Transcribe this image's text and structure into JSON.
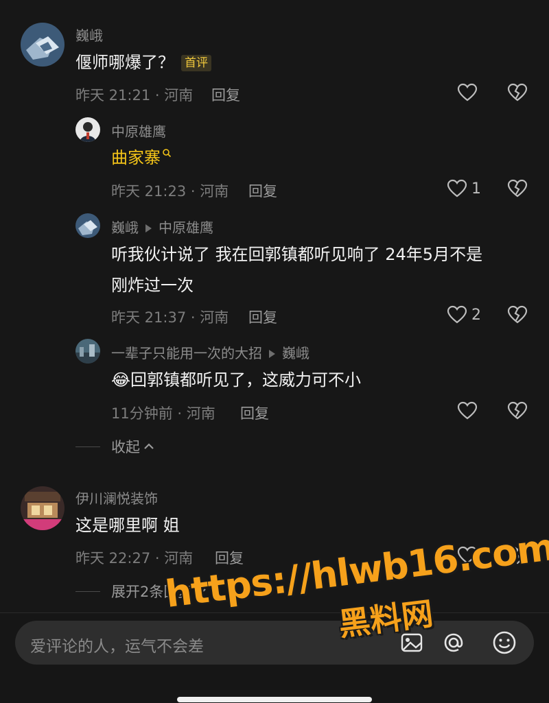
{
  "comments": [
    {
      "user": "巍峨",
      "text": "偃师哪爆了？",
      "badge": "首评",
      "time": "昨天 21:21 · 河南",
      "reply_label": "回复",
      "likes": ""
    },
    {
      "user": "伊川澜悦装饰",
      "text": "这是哪里啊 姐",
      "time": "昨天 22:27 · 河南",
      "reply_label": "回复",
      "likes": ""
    }
  ],
  "replies": [
    {
      "user": "中原雄鹰",
      "text": "曲家寨",
      "time": "昨天 21:23 · 河南",
      "reply_label": "回复",
      "likes": "1"
    },
    {
      "user": "巍峨",
      "reply_to": "中原雄鹰",
      "text_line1": "听我伙计说了 我在回郭镇都听见响了  24年5月不是",
      "text_line2": "刚炸过一次",
      "time": "昨天 21:37 · 河南",
      "reply_label": "回复",
      "likes": "2"
    },
    {
      "user": "一辈子只能用一次的大招",
      "reply_to": "巍峨",
      "text": "回郭镇都听见了，这威力可不小",
      "emoji": "😂",
      "time": "11分钟前 · 河南",
      "reply_label": "回复",
      "likes": ""
    }
  ],
  "collapse_label": "收起",
  "expand_label": "展开2条回复",
  "input": {
    "placeholder": "爱评论的人，运气不会差"
  },
  "watermark": {
    "line1": "https://hlwb16.com",
    "line2": "黑料网"
  },
  "colors": {
    "accent": "#f5c518",
    "watermark": "#f6a11b",
    "background": "#171717"
  }
}
